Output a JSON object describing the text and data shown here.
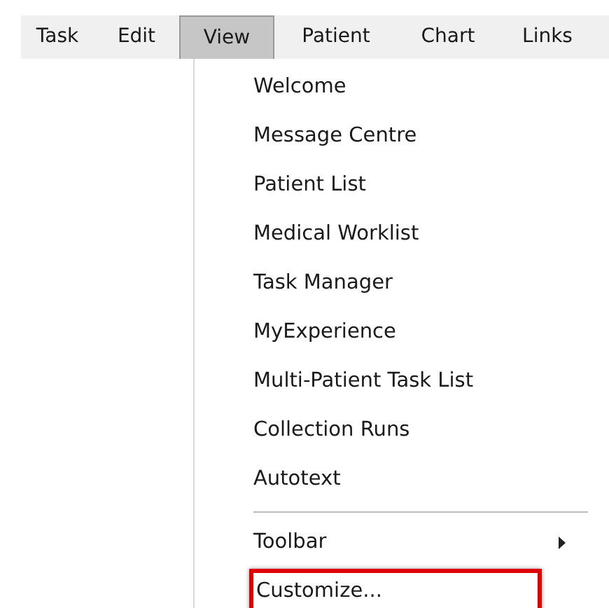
{
  "menu_bar": [
    {
      "label": "Task",
      "selected": false
    },
    {
      "label": "Edit",
      "selected": false
    },
    {
      "label": "View",
      "selected": true
    },
    {
      "label": "Patient",
      "selected": false
    },
    {
      "label": "Chart",
      "selected": false
    },
    {
      "label": "Links",
      "selected": false
    }
  ],
  "dropdown": {
    "items": [
      {
        "kind": "item",
        "label": "Welcome",
        "highlighted": false
      },
      {
        "kind": "item",
        "label": "Message Centre",
        "highlighted": false
      },
      {
        "kind": "item",
        "label": "Patient List",
        "highlighted": false
      },
      {
        "kind": "item",
        "label": "Medical Worklist",
        "highlighted": false
      },
      {
        "kind": "item",
        "label": "Task Manager",
        "highlighted": false
      },
      {
        "kind": "item",
        "label": "MyExperience",
        "highlighted": false
      },
      {
        "kind": "item",
        "label": "Multi-Patient Task List",
        "highlighted": false
      },
      {
        "kind": "item",
        "label": "Collection Runs",
        "highlighted": false
      },
      {
        "kind": "item",
        "label": "Autotext",
        "highlighted": false
      },
      {
        "kind": "separator"
      },
      {
        "kind": "submenu",
        "label": "Toolbar",
        "highlighted": false
      },
      {
        "kind": "item",
        "label": "Customize...",
        "highlighted": true
      }
    ]
  }
}
